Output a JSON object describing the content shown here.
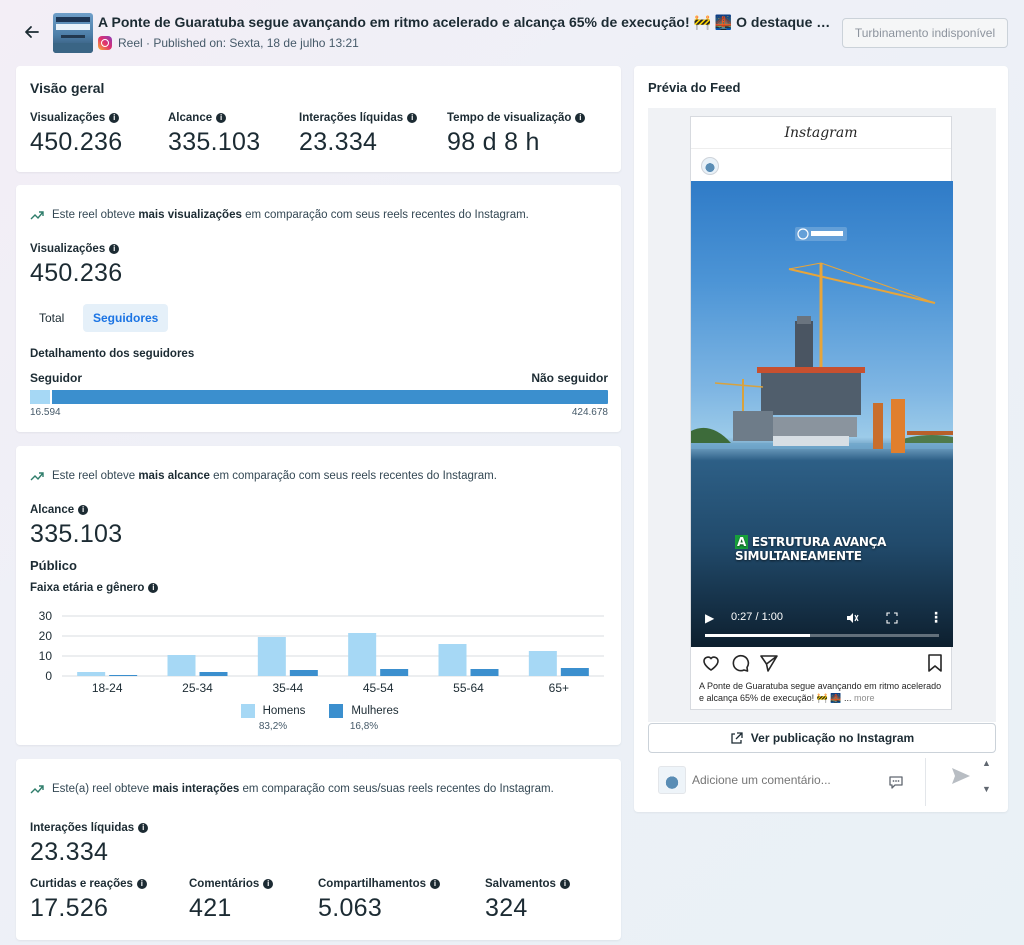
{
  "header": {
    "title": "A Ponte de Guaratuba segue avançando em ritmo acelerado e alcança 65% de execução! 🚧 🌉 O destaque vai para o vã...",
    "subtitle": "Reel · Published on: Sexta, 18 de julho 13:21",
    "boost_label": "Turbinamento indisponível"
  },
  "overview": {
    "title": "Visão geral",
    "metrics": [
      {
        "label": "Visualizações",
        "value": "450.236"
      },
      {
        "label": "Alcance",
        "value": "335.103"
      },
      {
        "label": "Interações líquidas",
        "value": "23.334"
      },
      {
        "label": "Tempo de visualização",
        "value": "98 d 8 h"
      }
    ]
  },
  "views_card": {
    "trend_pre": "Este reel obteve ",
    "trend_bold": "mais visualizações",
    "trend_post": " em comparação com seus reels recentes do Instagram.",
    "metric_label": "Visualizações",
    "metric_value": "450.236",
    "tabs": [
      "Total",
      "Seguidores"
    ],
    "active_tab": "Seguidores",
    "breakdown_title": "Detalhamento dos seguidores",
    "follower_label": "Seguidor",
    "nonfollower_label": "Não seguidor",
    "follower_value": "16.594",
    "nonfollower_value": "424.678",
    "follower_share": 0.0377
  },
  "reach_card": {
    "trend_pre": "Este reel obteve ",
    "trend_bold": "mais alcance",
    "trend_post": " em comparação com seus reels recentes do Instagram.",
    "metric_label": "Alcance",
    "metric_value": "335.103",
    "audience_title": "Público",
    "chart_title": "Faixa etária e gênero",
    "legend": [
      {
        "name": "Homens",
        "pct": "83,2%",
        "color": "#a6d8f5"
      },
      {
        "name": "Mulheres",
        "pct": "16,8%",
        "color": "#3b8fce"
      }
    ]
  },
  "chart_data": {
    "type": "bar",
    "categories": [
      "18-24",
      "25-34",
      "35-44",
      "45-54",
      "55-64",
      "65+"
    ],
    "series": [
      {
        "name": "Homens",
        "values": [
          2,
          10.5,
          19.5,
          21.5,
          16,
          12.5
        ],
        "color": "#a6d8f5"
      },
      {
        "name": "Mulheres",
        "values": [
          0.5,
          2,
          3,
          3.5,
          3.5,
          4
        ],
        "color": "#3b8fce"
      }
    ],
    "yticks": [
      0,
      10,
      20,
      30
    ],
    "ylim": [
      0,
      30
    ],
    "grid": true,
    "legend_position": "bottom"
  },
  "interactions_card": {
    "trend_pre": "Este(a) reel obteve ",
    "trend_bold": "mais interações",
    "trend_post": " em comparação com seus/suas reels recentes do Instagram.",
    "metric_label": "Interações líquidas",
    "metric_value": "23.334",
    "sub_metrics": [
      {
        "label": "Curtidas e reações",
        "value": "17.526"
      },
      {
        "label": "Comentários",
        "value": "421"
      },
      {
        "label": "Compartilhamentos",
        "value": "5.063"
      },
      {
        "label": "Salvamentos",
        "value": "324"
      }
    ]
  },
  "feed_preview": {
    "title": "Prévia do Feed",
    "ig_title": "Instagram",
    "video_overlay_highlight": "A",
    "video_overlay_text": " ESTRUTURA AVANÇA SIMULTANEAMENTE",
    "video_time": "0:27 / 1:00",
    "video_progress": 0.45,
    "caption": "A Ponte de Guaratuba segue avançando em ritmo acelerado e alcança 65% de execução! 🚧 🌉 ...",
    "caption_more": "more",
    "view_button": "Ver publicação no Instagram",
    "comment_placeholder": "Adicione um comentário..."
  }
}
